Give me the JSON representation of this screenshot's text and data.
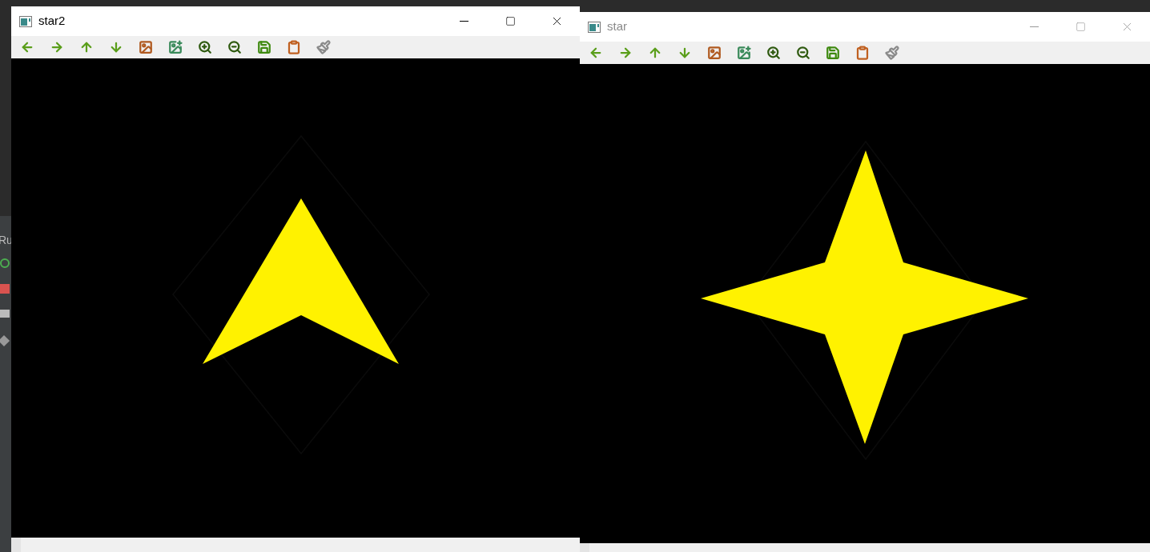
{
  "ide": {
    "panel_label": "Ru"
  },
  "windows": [
    {
      "title": "star2",
      "active": true,
      "kind": "arrow"
    },
    {
      "title": "star",
      "active": false,
      "kind": "star"
    }
  ]
}
